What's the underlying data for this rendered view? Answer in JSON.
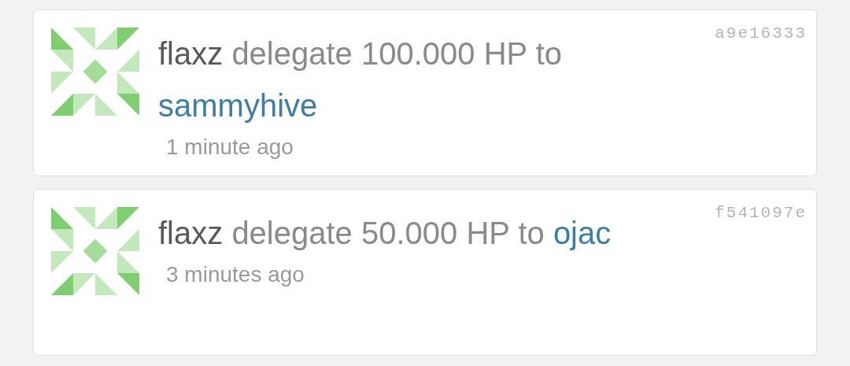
{
  "activities": [
    {
      "user": "flaxz",
      "action": "delegate 100.000 HP to",
      "target": "sammyhive",
      "time": "1 minute ago",
      "hash": "a9e16333"
    },
    {
      "user": "flaxz",
      "action": "delegate 50.000 HP to",
      "target": "ojac",
      "time": "3 minutes ago",
      "hash": "f541097e"
    }
  ]
}
